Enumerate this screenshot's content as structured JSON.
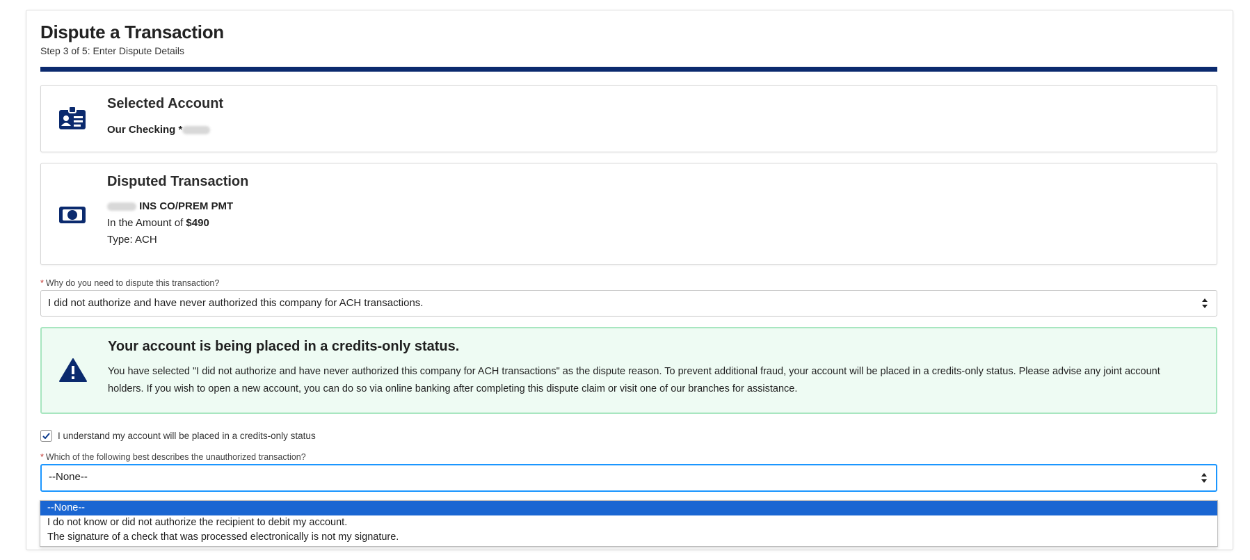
{
  "header": {
    "title": "Dispute a Transaction",
    "subtitle": "Step 3 of 5: Enter Dispute Details"
  },
  "selected_account": {
    "heading": "Selected Account",
    "account_name": "Our Checking *",
    "icon": "id-card-icon"
  },
  "disputed_transaction": {
    "heading": "Disputed Transaction",
    "merchant": "INS CO/PREM PMT",
    "amount_prefix": "In the Amount of ",
    "amount": "$490",
    "type_line": "Type: ACH",
    "icon": "money-bill-icon"
  },
  "reason_field": {
    "required_mark": "*",
    "label": "Why do you need to dispute this transaction?",
    "value": "I did not authorize and have never authorized this company for ACH transactions."
  },
  "alert": {
    "title": "Your account is being placed in a credits-only status.",
    "text": "You have selected \"I did not authorize and have never authorized this company for ACH transactions\" as the dispute reason. To prevent additional fraud, your account will be placed in a credits-only status. Please advise any joint account holders. If you wish to open a new account, you can do so via online banking after completing this dispute claim or visit one of our branches for assistance.",
    "icon": "warning-triangle-icon",
    "background_color": "#eefbf3",
    "border_color": "#a8e6c0"
  },
  "acknowledge": {
    "label": "I understand my account will be placed in a credits-only status",
    "checked": true
  },
  "description_field": {
    "required_mark": "*",
    "label": "Which of the following best describes the unauthorized transaction?",
    "value": "--None--",
    "options": [
      "--None--",
      "I do not know or did not authorize the recipient to debit my account.",
      "The signature of a check that was processed electronically is not my signature."
    ],
    "selected_index": 0
  },
  "colors": {
    "accent_rule": "#0b2a6e",
    "icon_navy": "#0b2a6e",
    "focus_border": "#1b96ff",
    "option_highlight": "#1a66d2",
    "required": "#c23934"
  }
}
